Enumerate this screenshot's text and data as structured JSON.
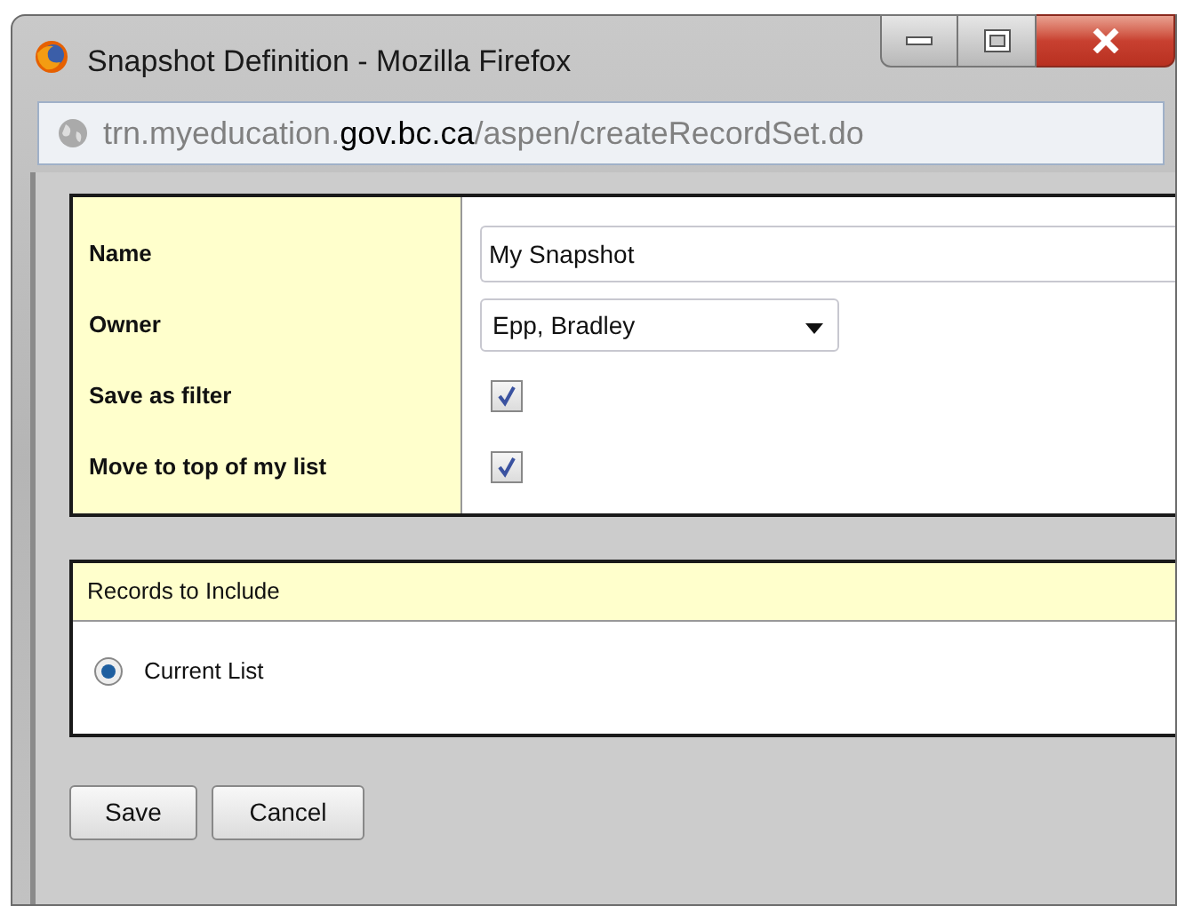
{
  "window": {
    "title": "Snapshot Definition - Mozilla Firefox",
    "url": "trn.myeducation.**gov.bc.ca**/aspen/createRecordSet.do"
  },
  "form": {
    "fields": [
      {
        "kind": "text",
        "label": "Name",
        "value": "My Snapshot"
      },
      {
        "kind": "select",
        "label": "Owner",
        "value": "Epp, Bradley"
      },
      {
        "kind": "checkbox",
        "label": "Save as filter",
        "checked": true
      },
      {
        "kind": "checkbox",
        "label": "Move to top of my list",
        "checked": true
      }
    ]
  },
  "records": {
    "heading": "Records to Include",
    "options": [
      {
        "label": "Current List",
        "selected": true
      }
    ]
  },
  "buttons": [
    "Save",
    "Cancel"
  ]
}
